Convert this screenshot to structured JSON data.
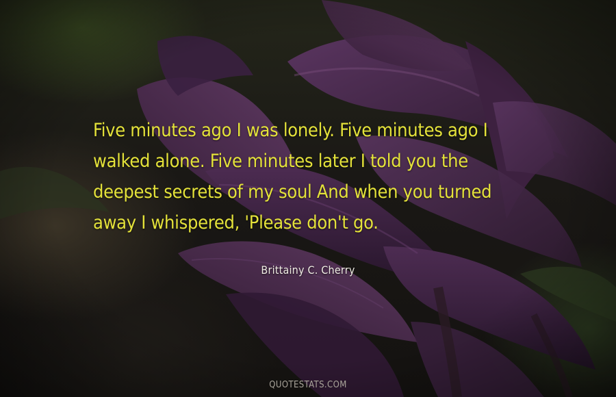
{
  "quote": {
    "text": "Five minutes ago I was lonely. Five minutes ago I walked alone. Five minutes later I told you the deepest secrets of my soul And when you turned away I whispered, 'Please don't go."
  },
  "author": {
    "name": "Brittainy C. Cherry"
  },
  "watermark": {
    "text": "QUOTESTATS.COM"
  },
  "colors": {
    "quote_text": "#e4e23a",
    "author_text": "#f0ede4",
    "petal": "#4a2a4c"
  },
  "background": {
    "subject": "purple-lily-flowers"
  }
}
